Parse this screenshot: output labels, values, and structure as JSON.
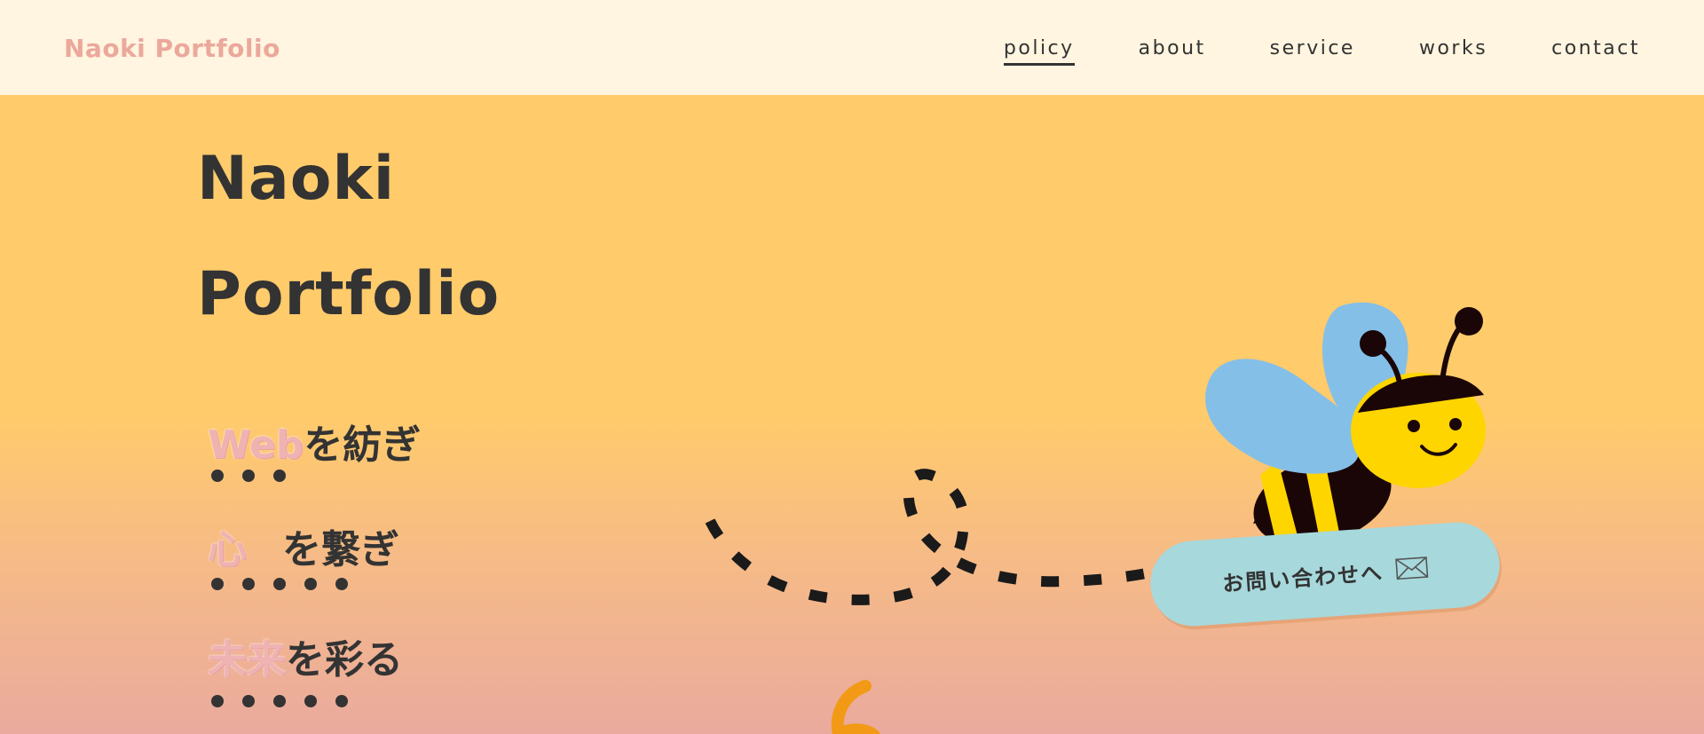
{
  "header": {
    "logo": "Naoki Portfolio",
    "nav": [
      {
        "label": "policy",
        "active": true
      },
      {
        "label": "about",
        "active": false
      },
      {
        "label": "service",
        "active": false
      },
      {
        "label": "works",
        "active": false
      },
      {
        "label": "contact",
        "active": false
      }
    ]
  },
  "hero": {
    "title_line1": "Naoki",
    "title_line2": "Portfolio",
    "taglines": [
      {
        "highlight": "Web",
        "rest": "を紡ぎ"
      },
      {
        "highlight": "心",
        "rest": "を繋ぎ"
      },
      {
        "highlight": "未来",
        "rest": "を彩る"
      }
    ],
    "cta_label": "お問い合わせへ",
    "cta_icon": "envelope-icon",
    "mascot": "bee-icon"
  },
  "colors": {
    "header_bg": "#fff5e0",
    "hero_top": "#ffcb6b",
    "hero_bottom": "#eaaa9e",
    "logo": "#eba89b",
    "cta_bg": "#a7d8dc",
    "bee_wing": "#84bfe8",
    "bee_yellow": "#ffd500"
  }
}
